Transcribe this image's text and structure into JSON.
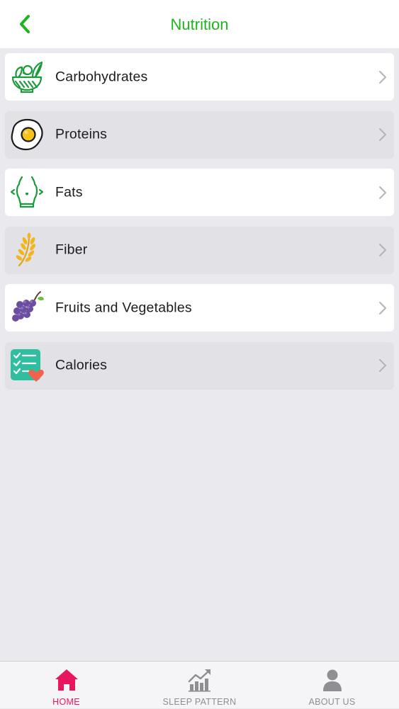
{
  "header": {
    "title": "Nutrition",
    "back_icon": "chevron-left-icon",
    "accent_color": "#1fb31f"
  },
  "items": [
    {
      "label": "Carbohydrates",
      "icon": "salad-bowl-icon"
    },
    {
      "label": "Proteins",
      "icon": "fried-egg-icon"
    },
    {
      "label": "Fats",
      "icon": "belly-icon"
    },
    {
      "label": "Fiber",
      "icon": "wheat-icon"
    },
    {
      "label": "Fruits and Vegetables",
      "icon": "grapes-icon"
    },
    {
      "label": "Calories",
      "icon": "checklist-heart-icon"
    }
  ],
  "tabbar": {
    "active_color": "#e8175d",
    "inactive_color": "#8e8e93",
    "tabs": [
      {
        "label": "HOME",
        "icon": "home-icon",
        "active": true
      },
      {
        "label": "SLEEP PATTERN",
        "icon": "chart-trend-icon",
        "active": false
      },
      {
        "label": "ABOUT US",
        "icon": "person-icon",
        "active": false
      }
    ]
  }
}
